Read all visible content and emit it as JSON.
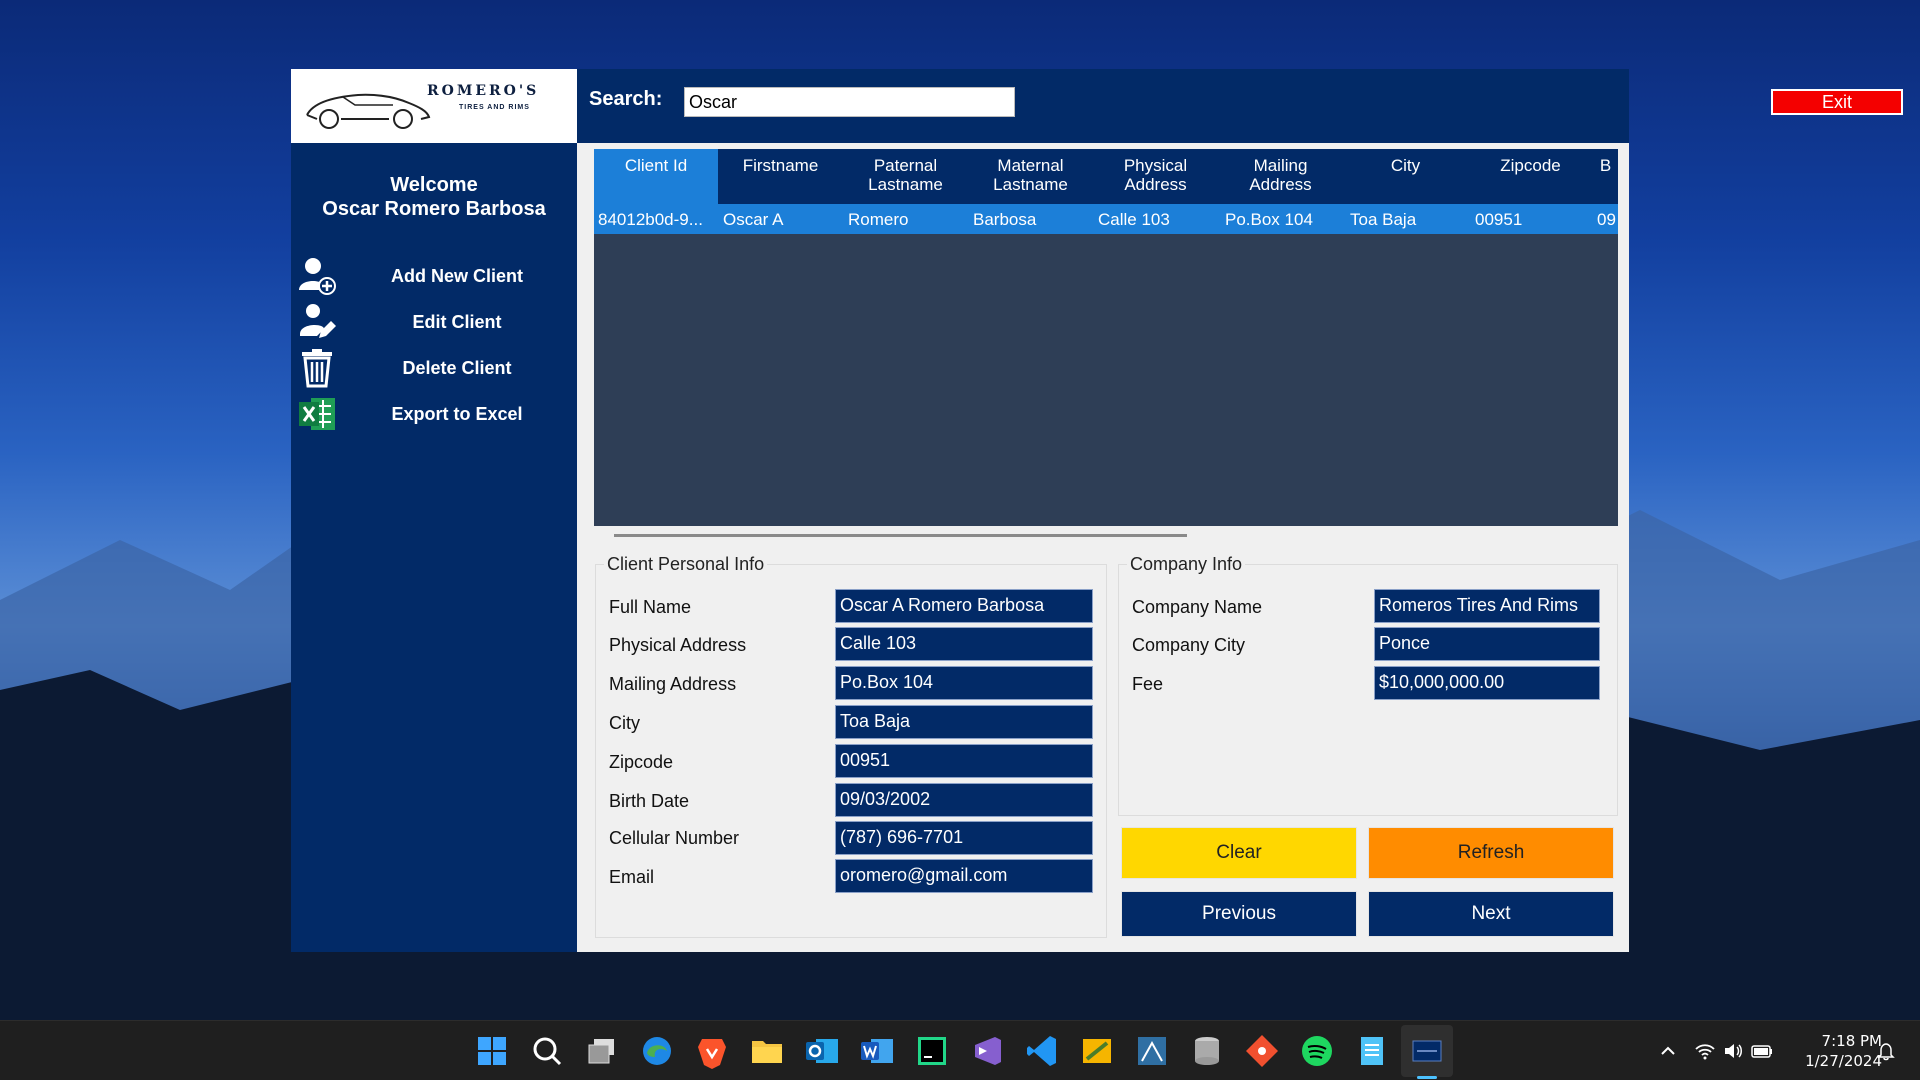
{
  "app": {
    "logo": {
      "title": "ROMERO'S",
      "subtitle": "TIRES AND RIMS"
    },
    "welcome": {
      "line1": "Welcome",
      "line2": "Oscar Romero Barbosa"
    },
    "nav": [
      {
        "label": "Add New Client",
        "icon": "add-user-icon"
      },
      {
        "label": "Edit Client",
        "icon": "edit-user-icon"
      },
      {
        "label": "Delete Client",
        "icon": "trash-icon"
      },
      {
        "label": "Export to Excel",
        "icon": "excel-icon"
      }
    ],
    "search": {
      "label": "Search:",
      "value": "Oscar"
    },
    "exit_label": "Exit",
    "grid": {
      "headers": [
        {
          "l1": "Client Id",
          "l2": ""
        },
        {
          "l1": "Firstname",
          "l2": ""
        },
        {
          "l1": "Paternal",
          "l2": "Lastname"
        },
        {
          "l1": "Maternal",
          "l2": "Lastname"
        },
        {
          "l1": "Physical",
          "l2": "Address"
        },
        {
          "l1": "Mailing",
          "l2": "Address"
        },
        {
          "l1": "City",
          "l2": ""
        },
        {
          "l1": "Zipcode",
          "l2": ""
        },
        {
          "l1": "B",
          "l2": ""
        }
      ],
      "rows": [
        [
          "84012b0d-9...",
          "Oscar A",
          "Romero",
          "Barbosa",
          "Calle 103",
          "Po.Box 104",
          "Toa Baja",
          "00951",
          "09"
        ]
      ]
    },
    "personal": {
      "title": "Client Personal Info",
      "fields": [
        {
          "label": "Full Name",
          "value": "Oscar A Romero Barbosa"
        },
        {
          "label": "Physical Address",
          "value": "Calle 103"
        },
        {
          "label": "Mailing Address",
          "value": "Po.Box 104"
        },
        {
          "label": "City",
          "value": "Toa Baja"
        },
        {
          "label": "Zipcode",
          "value": "00951"
        },
        {
          "label": "Birth Date",
          "value": "09/03/2002"
        },
        {
          "label": "Cellular Number",
          "value": "(787) 696-7701"
        },
        {
          "label": "Email",
          "value": "oromero@gmail.com"
        }
      ]
    },
    "company": {
      "title": "Company Info",
      "fields": [
        {
          "label": "Company Name",
          "value": "Romeros Tires And Rims"
        },
        {
          "label": "Company City",
          "value": "Ponce"
        },
        {
          "label": "Fee",
          "value": "$10,000,000.00"
        }
      ]
    },
    "buttons": {
      "clear": "Clear",
      "refresh": "Refresh",
      "previous": "Previous",
      "next": "Next"
    }
  },
  "taskbar": {
    "icons": [
      "windows-start-icon",
      "search-icon",
      "task-view-icon",
      "edge-icon",
      "brave-icon",
      "file-explorer-icon",
      "outlook-icon",
      "word-icon",
      "pycharm-icon",
      "visual-studio-icon",
      "vscode-icon",
      "app-icon",
      "app-icon",
      "database-icon",
      "git-icon",
      "spotify-icon",
      "notepad-icon",
      "app-window-icon"
    ],
    "time": "7:18 PM",
    "date": "1/27/2024"
  },
  "colors": {
    "navy": "#022a67",
    "selection": "#1c7fd8",
    "exit": "#f40000",
    "clear": "#ffd700",
    "refresh": "#ff8c00"
  }
}
